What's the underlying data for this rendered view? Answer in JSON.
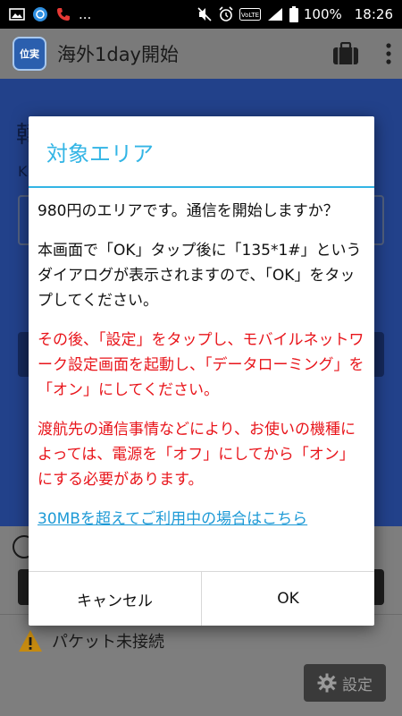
{
  "status_bar": {
    "left_more": "...",
    "battery_percent": "100%",
    "time": "18:26"
  },
  "app_bar": {
    "logo_text": "位実",
    "title": "海外1day開始"
  },
  "background": {
    "heading_char": "韓",
    "sub_char": "K",
    "warning_text": "パケット未接続",
    "settings_label": "設定"
  },
  "dialog": {
    "title": "対象エリア",
    "para1": "980円のエリアです。通信を開始しますか？",
    "para2": "本画面で「OK」タップ後に「135*1#」というダイアログが表示されますので、「OK」をタップしてください。",
    "para3": "その後、「設定」をタップし、モバイルネットワーク設定画面を起動し、「データローミング」を「オン」にしてください。",
    "para4": "渡航先の通信事情などにより、お使いの機種によっては、電源を「オフ」にしてから「オン」にする必要があります。",
    "link": "30MBを超えてご利用中の場合はこちら",
    "cancel_label": "キャンセル",
    "ok_label": "OK"
  },
  "colors": {
    "accent": "#33b5e5",
    "warning_red": "#e8151b",
    "link": "#1e9ad6"
  },
  "icons": [
    "gallery-icon",
    "browser-icon",
    "missed-call-icon",
    "mute-icon",
    "alarm-icon",
    "volte-icon",
    "signal-icon",
    "battery-icon",
    "briefcase-icon",
    "overflow-menu-icon",
    "warning-icon",
    "gear-icon"
  ]
}
